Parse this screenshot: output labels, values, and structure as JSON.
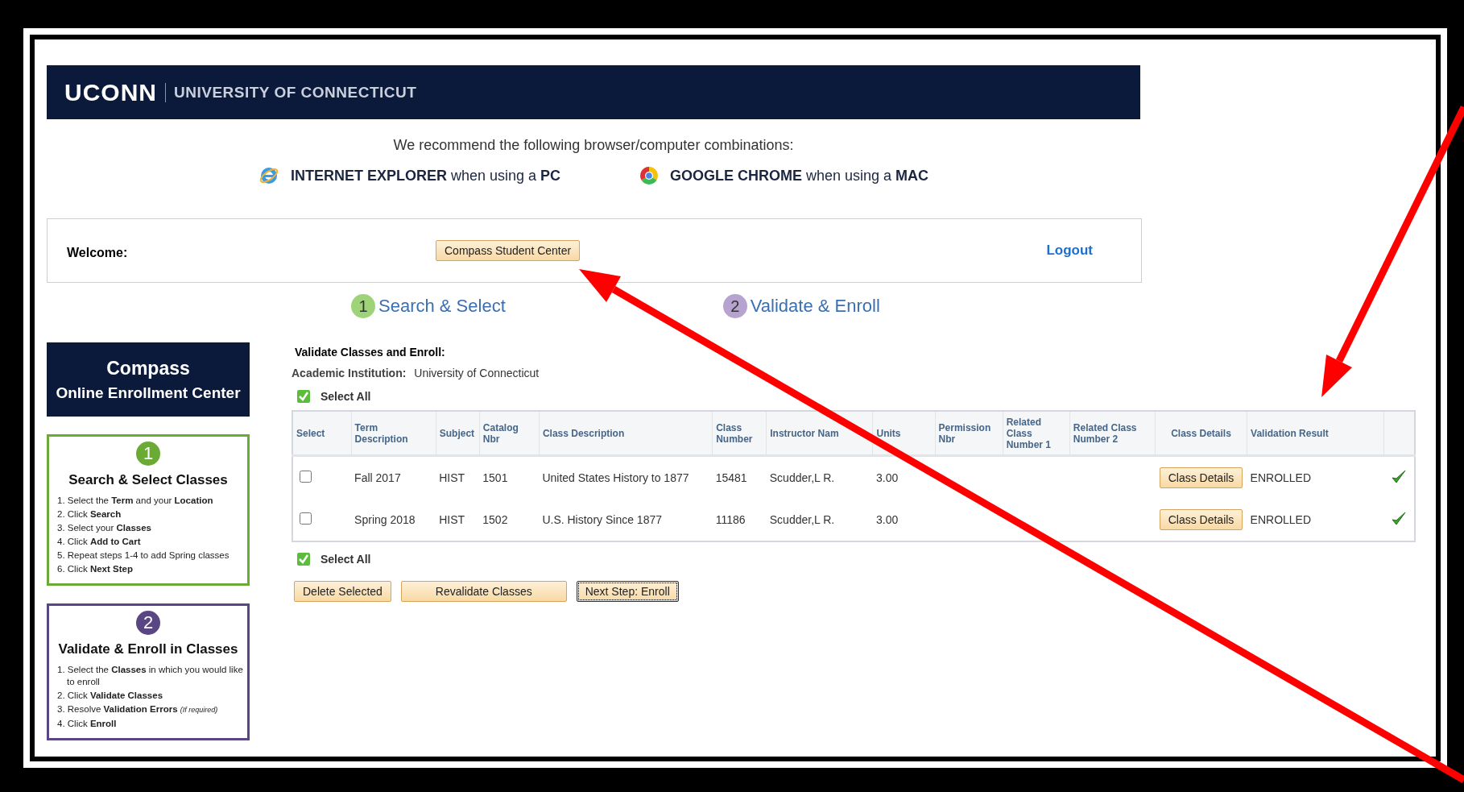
{
  "header": {
    "logo": "UCONN",
    "name": "UNIVERSITY OF CONNECTICUT"
  },
  "recommendation": {
    "text": "We recommend the following browser/computer combinations:",
    "browsers": [
      {
        "kind": "ie",
        "text": "**INTERNET EXPLORER** when using a **PC**"
      },
      {
        "kind": "chrome",
        "text": "**GOOGLE CHROME** when using a **MAC**"
      }
    ]
  },
  "welcome": {
    "label": "Welcome:",
    "button": "Compass Student Center",
    "logout": "Logout"
  },
  "steps": [
    {
      "number": "1",
      "label": "Search & Select",
      "color": "#9fd37a"
    },
    {
      "number": "2",
      "label": "Validate & Enroll",
      "color": "#b7a3cf"
    }
  ],
  "sidebar": {
    "title": "Compass",
    "subtitle": "Online Enrollment Center",
    "panels": [
      {
        "number": "1",
        "title": "Search & Select Classes",
        "color": "#6aaa35",
        "items": [
          "1. Select the **Term** and your **Location**",
          "2. Click **Search**",
          "3. Select your **Classes**",
          "4. Click **Add to Cart**",
          "5. Repeat steps 1-4 to add Spring classes",
          "6. Click **Next Step**"
        ]
      },
      {
        "number": "2",
        "title": "Validate & Enroll in Classes",
        "color": "#5b4684",
        "items": [
          "1. Select the **Classes** in which you would like to enroll",
          "2. Click **Validate Classes**",
          "3. Resolve **Validation Errors** *(If required)*",
          "4. Click **Enroll**"
        ]
      }
    ]
  },
  "main": {
    "title": "Validate Classes and Enroll:",
    "institution_label": "Academic Institution:",
    "institution": "University of Connecticut",
    "select_all": [
      "Select All",
      "Select All"
    ],
    "table": {
      "columns": [
        "Select",
        "Term Description",
        "Subject",
        "Catalog Nbr",
        "Class Description",
        "Class Number",
        "Instructor Nam",
        "Units",
        "Permission Nbr",
        "Related Class Number 1",
        "Related Class Number 2",
        "Class Details",
        "Validation Result"
      ],
      "rows": [
        {
          "selected": false,
          "term": "Fall 2017",
          "subject": "HIST",
          "catalog": "1501",
          "description": "United States History to 1877",
          "class_number": "15481",
          "instructor": "Scudder,L R.",
          "units": "3.00",
          "details_button": "Class Details",
          "result": "ENROLLED",
          "validated": true
        },
        {
          "selected": false,
          "term": "Spring 2018",
          "subject": "HIST",
          "catalog": "1502",
          "description": "U.S.  History Since 1877",
          "class_number": "11186",
          "instructor": "Scudder,L R.",
          "units": "3.00",
          "details_button": "Class Details",
          "result": "ENROLLED",
          "validated": true
        }
      ]
    },
    "buttons": [
      {
        "label": "Delete Selected",
        "focused": false
      },
      {
        "label": "Revalidate Classes",
        "focused": false
      },
      {
        "label": "Next Step: Enroll",
        "focused": true
      }
    ]
  }
}
